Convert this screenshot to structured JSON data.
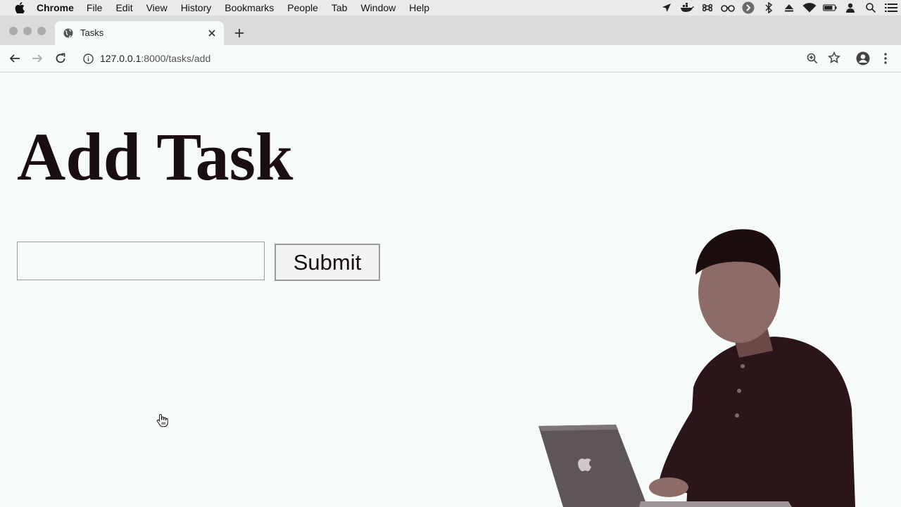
{
  "menubar": {
    "app_name": "Chrome",
    "items": [
      "File",
      "Edit",
      "View",
      "History",
      "Bookmarks",
      "People",
      "Tab",
      "Window",
      "Help"
    ],
    "status_icons": [
      "location-icon",
      "docker-icon",
      "command-icon",
      "glasses-icon",
      "circle-arrow-icon",
      "bluetooth-icon",
      "eject-icon",
      "wifi-icon",
      "battery-icon",
      "user-icon",
      "search-icon",
      "list-icon"
    ]
  },
  "tab": {
    "title": "Tasks"
  },
  "toolbar": {
    "url_host": "127.0.0.1",
    "url_path": ":8000/tasks/add"
  },
  "page": {
    "title": "Add Task",
    "task_input_value": "",
    "submit_label": "Submit"
  },
  "colors": {
    "page_background": "#f6faf8",
    "heading_text": "#1b0e10",
    "chrome_frame": "#d9dcdb"
  }
}
